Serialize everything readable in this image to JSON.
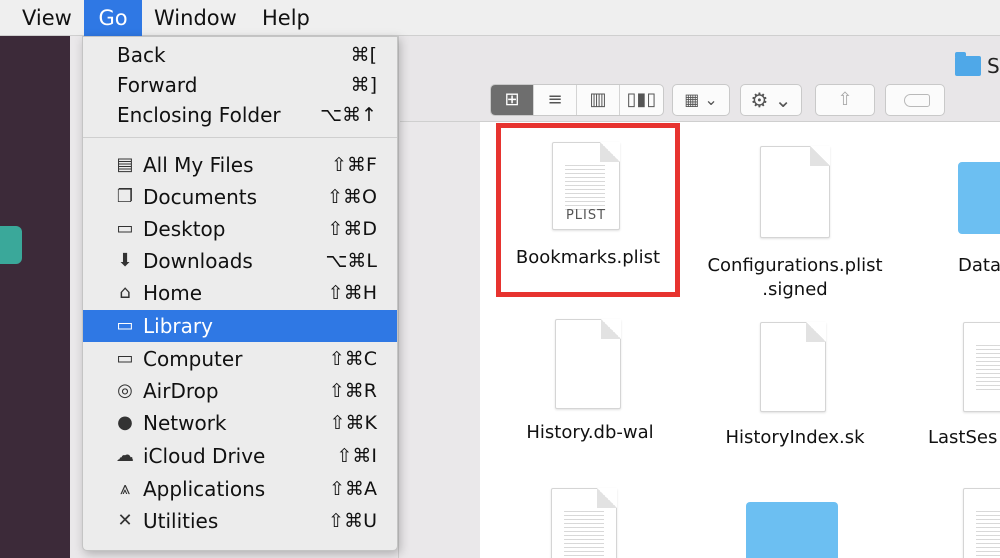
{
  "menubar": {
    "items": [
      "View",
      "Go",
      "Window",
      "Help"
    ]
  },
  "window_title": "S",
  "toolbar": {
    "view_buttons": [
      "icon-view-icon",
      "list-view-icon",
      "column-view-icon",
      "cover-flow-icon"
    ],
    "arrange_icon": "arrange-icon",
    "action_icon": "gear-icon",
    "share_icon": "share-icon",
    "tag_icon": "tag-icon"
  },
  "go_menu": {
    "items": [
      {
        "label": "Back",
        "shortcut": "⌘[",
        "icon": ""
      },
      {
        "label": "Forward",
        "shortcut": "⌘]",
        "icon": ""
      },
      {
        "label": "Enclosing Folder",
        "shortcut": "⌥⌘↑",
        "icon": ""
      },
      {
        "label": "All My Files",
        "shortcut": "⇧⌘F",
        "icon": "all-my-files-icon"
      },
      {
        "label": "Documents",
        "shortcut": "⇧⌘O",
        "icon": "documents-icon"
      },
      {
        "label": "Desktop",
        "shortcut": "⇧⌘D",
        "icon": "desktop-icon"
      },
      {
        "label": "Downloads",
        "shortcut": "⌥⌘L",
        "icon": "downloads-icon"
      },
      {
        "label": "Home",
        "shortcut": "⇧⌘H",
        "icon": "home-icon"
      },
      {
        "label": "Library",
        "shortcut": "",
        "icon": "library-folder-icon",
        "selected": true
      },
      {
        "label": "Computer",
        "shortcut": "⇧⌘C",
        "icon": "computer-icon"
      },
      {
        "label": "AirDrop",
        "shortcut": "⇧⌘R",
        "icon": "airdrop-icon"
      },
      {
        "label": "Network",
        "shortcut": "⇧⌘K",
        "icon": "network-icon"
      },
      {
        "label": "iCloud Drive",
        "shortcut": "⇧⌘I",
        "icon": "icloud-icon"
      },
      {
        "label": "Applications",
        "shortcut": "⇧⌘A",
        "icon": "applications-icon"
      },
      {
        "label": "Utilities",
        "shortcut": "⇧⌘U",
        "icon": "utilities-icon"
      }
    ]
  },
  "files": [
    {
      "name": "Bookmarks.plist",
      "ext": "PLIST",
      "kind": "plist"
    },
    {
      "name": "Configurations.plist",
      "name2": ".signed",
      "kind": "doc"
    },
    {
      "name": "Data",
      "kind": "folder"
    },
    {
      "name": "History.db-wal",
      "kind": "doc"
    },
    {
      "name": "HistoryIndex.sk",
      "kind": "doc"
    },
    {
      "name": "LastSes",
      "kind": "plist"
    },
    {
      "name": "",
      "kind": "plist"
    },
    {
      "name": "",
      "kind": "folder"
    },
    {
      "name": "",
      "kind": "plist"
    }
  ],
  "colors": {
    "accent": "#2f78e4",
    "highlight_border": "#e7332f",
    "folder": "#6cbff2"
  }
}
